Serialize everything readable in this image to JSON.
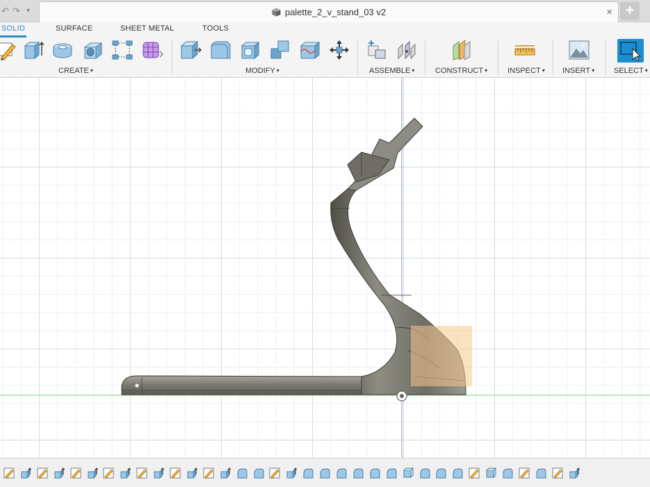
{
  "document": {
    "title": "palette_2_v_stand_03 v2",
    "close_glyph": "×",
    "new_tab_glyph": "+"
  },
  "quick_access": {
    "undo_icon": "↶",
    "redo_icon": "↷",
    "dropdown_icon": "▾"
  },
  "workspace_tabs": [
    {
      "label": "SOLID",
      "active": true
    },
    {
      "label": "SURFACE",
      "active": false
    },
    {
      "label": "SHEET METAL",
      "active": false
    },
    {
      "label": "TOOLS",
      "active": false
    }
  ],
  "toolbar": {
    "groups": {
      "create": "CREATE",
      "modify": "MODIFY",
      "assemble": "ASSEMBLE",
      "construct": "CONSTRUCT",
      "inspect": "INSPECT",
      "insert": "INSERT",
      "select": "SELECT"
    },
    "caret": "▾"
  },
  "colors": {
    "accent": "#2a8cc7",
    "select_button": "#1e8ed1",
    "model_body": "#8a8a80",
    "selection_highlight": "#f5c88a",
    "ground_line": "#7fd07f",
    "axis_line": "#8aa0c0"
  },
  "timeline": {
    "item_icons": [
      "sketch-icon",
      "extrude-icon",
      "sketch-icon",
      "extrude-icon",
      "sketch-icon",
      "extrude-icon",
      "sketch-icon",
      "extrude-icon",
      "sketch-icon",
      "extrude-icon",
      "sketch-icon",
      "extrude-icon",
      "sketch-icon",
      "extrude-icon",
      "fillet-icon",
      "fillet-icon",
      "sketch-icon",
      "extrude-icon",
      "fillet-icon",
      "fillet-icon",
      "fillet-icon",
      "fillet-icon",
      "fillet-icon",
      "fillet-icon",
      "box-icon",
      "fillet-icon",
      "fillet-icon",
      "fillet-icon",
      "sketch-icon",
      "box-icon",
      "fillet-icon",
      "sketch-icon",
      "fillet-icon",
      "sketch-icon",
      "extrude-icon"
    ]
  }
}
